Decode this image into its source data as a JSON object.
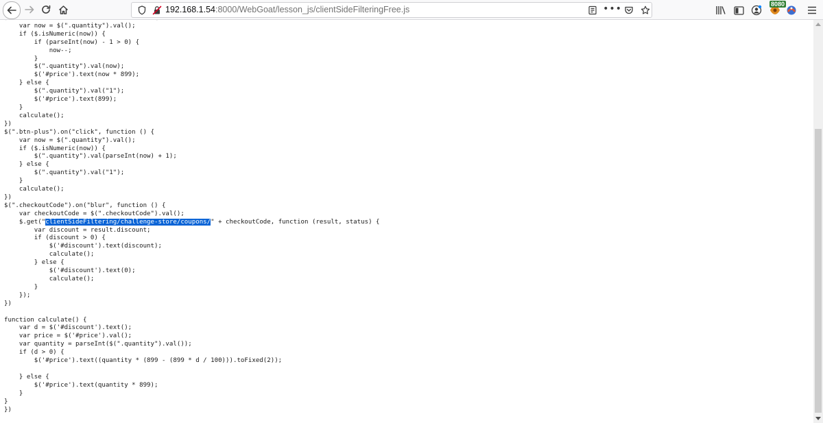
{
  "browser": {
    "url_host": "192.168.1.54",
    "url_path": ":8000/WebGoat/lesson_js/clientSideFilteringFree.js",
    "proxy_badge": "8080",
    "colors": {
      "selection": "#0a64d6",
      "insecure": "#d70022",
      "badge": "#2e7d32"
    },
    "icons": [
      "back-icon",
      "forward-icon",
      "reload-icon",
      "home-icon",
      "shield-icon",
      "insecure-lock-icon",
      "reader-view-icon",
      "page-actions-icon",
      "pocket-icon",
      "bookmark-star-icon",
      "library-icon",
      "sidebar-icon",
      "account-icon",
      "proxy-icon",
      "foxyproxy-icon",
      "hamburger-menu-icon"
    ]
  },
  "code": {
    "before_selection": "$(\".btn-minus\").on(\"click\", function () {\n    var now = $(\".quantity\").val();\n    if ($.isNumeric(now)) {\n        if (parseInt(now) - 1 > 0) {\n            now--;\n        }\n        $(\".quantity\").val(now);\n        $('#price').text(now * 899);\n    } else {\n        $(\".quantity\").val(\"1\");\n        $('#price').text(899);\n    }\n    calculate();\n})\n$(\".btn-plus\").on(\"click\", function () {\n    var now = $(\".quantity\").val();\n    if ($.isNumeric(now)) {\n        $(\".quantity\").val(parseInt(now) + 1);\n    } else {\n        $(\".quantity\").val(\"1\");\n    }\n    calculate();\n})\n$(\".checkoutCode\").on(\"blur\", function () {\n    var checkoutCode = $(\".checkoutCode\").val();\n    $.get(\"",
    "selection": "clientSideFiltering/challenge-store/coupons/",
    "after_selection": "\" + checkoutCode, function (result, status) {\n        var discount = result.discount;\n        if (discount > 0) {\n            $('#discount').text(discount);\n            calculate();\n        } else {\n            $('#discount').text(0);\n            calculate();\n        }\n    });\n})\n\nfunction calculate() {\n    var d = $('#discount').text();\n    var price = $('#price').val();\n    var quantity = parseInt($(\".quantity\").val());\n    if (d > 0) {\n        $('#price').text((quantity * (899 - (899 * d / 100))).toFixed(2));\n\n    } else {\n        $('#price').text(quantity * 899);\n    }\n}\n})"
  }
}
